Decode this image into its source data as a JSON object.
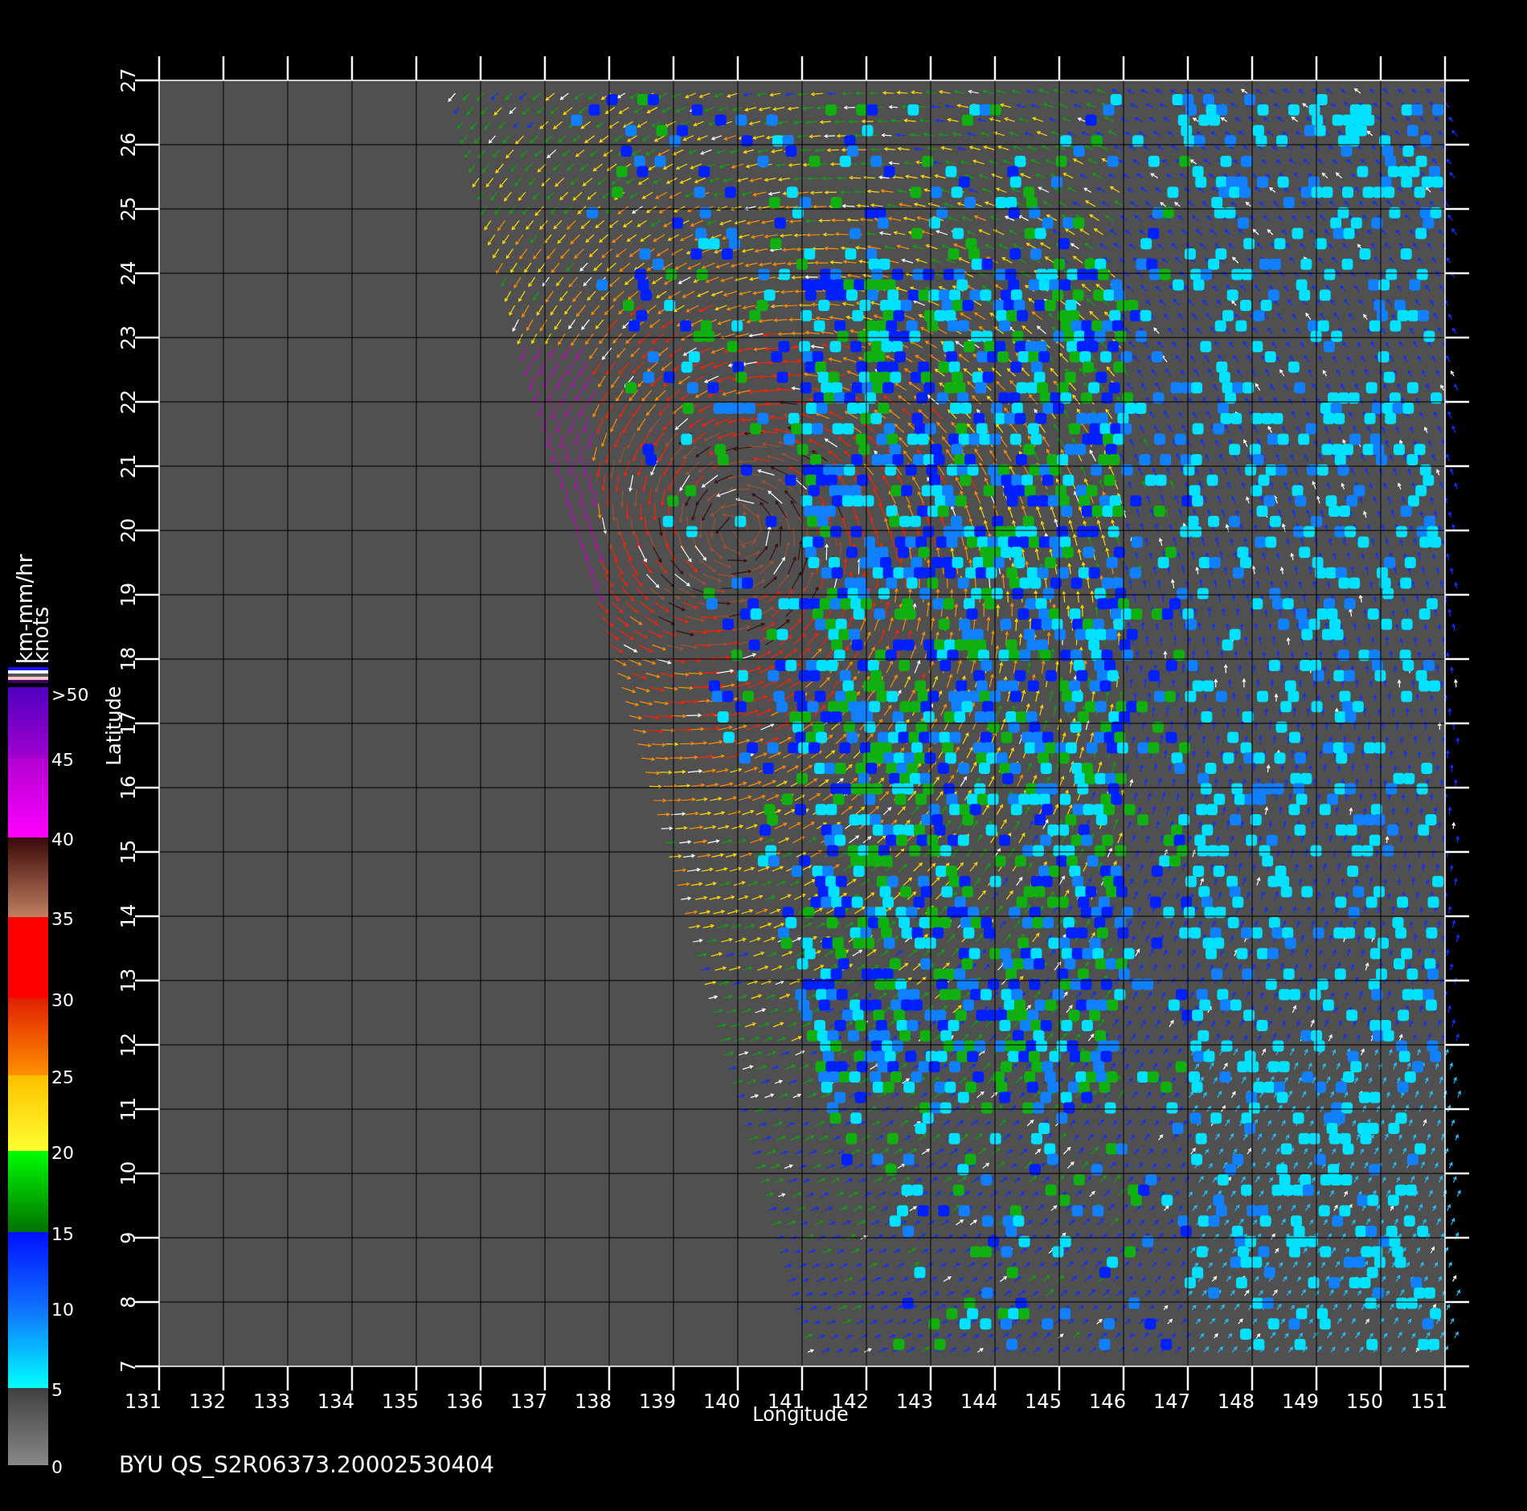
{
  "plot": {
    "x_axis": {
      "title": "Longitude",
      "tick_labels": [
        "131",
        "132",
        "133",
        "134",
        "135",
        "136",
        "137",
        "138",
        "139",
        "140",
        "141",
        "142",
        "143",
        "144",
        "145",
        "146",
        "147",
        "148",
        "149",
        "150",
        "151"
      ]
    },
    "y_axis": {
      "title": "Latitude",
      "tick_labels": [
        "7",
        "8",
        "9",
        "10",
        "11",
        "12",
        "13",
        "14",
        "15",
        "16",
        "17",
        "18",
        "19",
        "20",
        "21",
        "22",
        "23",
        "24",
        "25",
        "26",
        "27"
      ]
    }
  },
  "colorbar": {
    "unit_labels": [
      "km-mm/hr",
      "knots"
    ],
    "tick_labels": [
      ">50",
      "45",
      "40",
      "35",
      "30",
      "25",
      "20",
      "15",
      "10",
      "5",
      "0"
    ]
  },
  "footer": "BYU QS_S2R06373.20002530404"
}
